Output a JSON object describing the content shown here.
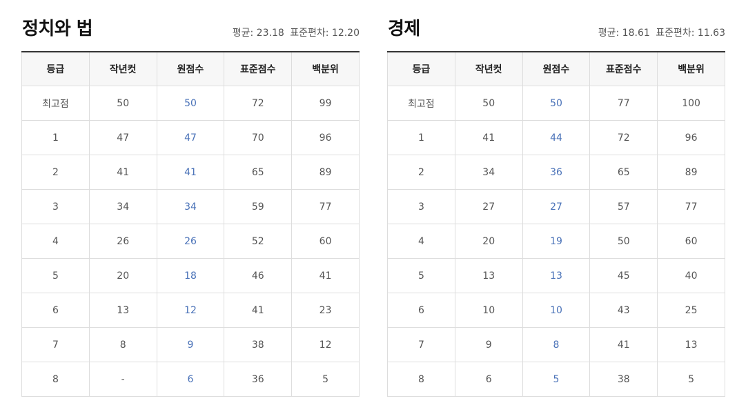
{
  "columns": [
    "등급",
    "작년컷",
    "원점수",
    "표준점수",
    "백분위"
  ],
  "panels": [
    {
      "title": "정치와 법",
      "mean": "평균: 23.18",
      "stdev": "표준편차: 12.20",
      "rows": [
        [
          "최고점",
          "50",
          "50",
          "72",
          "99"
        ],
        [
          "1",
          "47",
          "47",
          "70",
          "96"
        ],
        [
          "2",
          "41",
          "41",
          "65",
          "89"
        ],
        [
          "3",
          "34",
          "34",
          "59",
          "77"
        ],
        [
          "4",
          "26",
          "26",
          "52",
          "60"
        ],
        [
          "5",
          "20",
          "18",
          "46",
          "41"
        ],
        [
          "6",
          "13",
          "12",
          "41",
          "23"
        ],
        [
          "7",
          "8",
          "9",
          "38",
          "12"
        ],
        [
          "8",
          "-",
          "6",
          "36",
          "5"
        ]
      ]
    },
    {
      "title": "경제",
      "mean": "평균: 18.61",
      "stdev": "표준편차: 11.63",
      "rows": [
        [
          "최고점",
          "50",
          "50",
          "77",
          "100"
        ],
        [
          "1",
          "41",
          "44",
          "72",
          "96"
        ],
        [
          "2",
          "34",
          "36",
          "65",
          "89"
        ],
        [
          "3",
          "27",
          "27",
          "57",
          "77"
        ],
        [
          "4",
          "20",
          "19",
          "50",
          "60"
        ],
        [
          "5",
          "13",
          "13",
          "45",
          "40"
        ],
        [
          "6",
          "10",
          "10",
          "43",
          "25"
        ],
        [
          "7",
          "9",
          "8",
          "41",
          "13"
        ],
        [
          "8",
          "6",
          "5",
          "38",
          "5"
        ]
      ]
    }
  ],
  "colors": {
    "raw_score_text": "#4a72b8",
    "header_bg": "#f7f7f7",
    "table_top_border": "#333333",
    "cell_border": "#dddddd"
  }
}
